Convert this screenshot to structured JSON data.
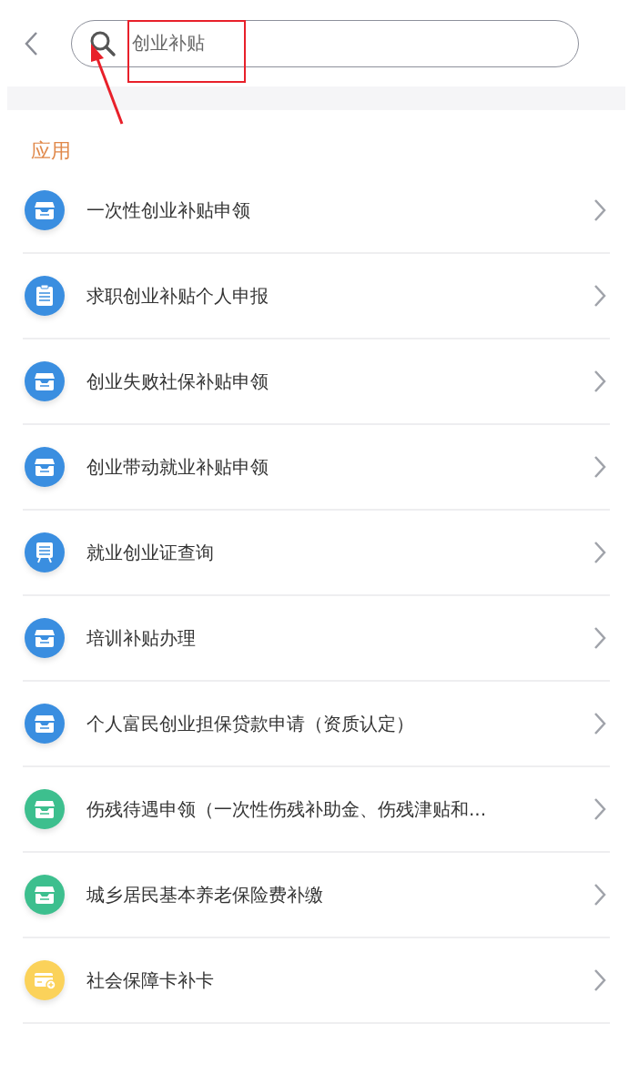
{
  "search": {
    "value": "创业补贴"
  },
  "section": {
    "title": "应用"
  },
  "items": [
    {
      "label": "一次性创业补贴申领",
      "kind": "tray",
      "color": "#3a8ee0"
    },
    {
      "label": "求职创业补贴个人申报",
      "kind": "clipboard",
      "color": "#3a8ee0"
    },
    {
      "label": "创业失败社保补贴申领",
      "kind": "tray",
      "color": "#3a8ee0"
    },
    {
      "label": "创业带动就业补贴申领",
      "kind": "tray",
      "color": "#3a8ee0"
    },
    {
      "label": "就业创业证查询",
      "kind": "board",
      "color": "#3a8ee0"
    },
    {
      "label": "培训补贴办理",
      "kind": "tray",
      "color": "#3a8ee0"
    },
    {
      "label": "个人富民创业担保贷款申请（资质认定）",
      "kind": "tray",
      "color": "#3a8ee0"
    },
    {
      "label": "伤残待遇申领（一次性伤残补助金、伤残津贴和...",
      "kind": "tray",
      "color": "#3dbf8e"
    },
    {
      "label": "城乡居民基本养老保险费补缴",
      "kind": "tray",
      "color": "#3dbf8e"
    },
    {
      "label": "社会保障卡补卡",
      "kind": "card",
      "color": "#fbd25a"
    }
  ]
}
